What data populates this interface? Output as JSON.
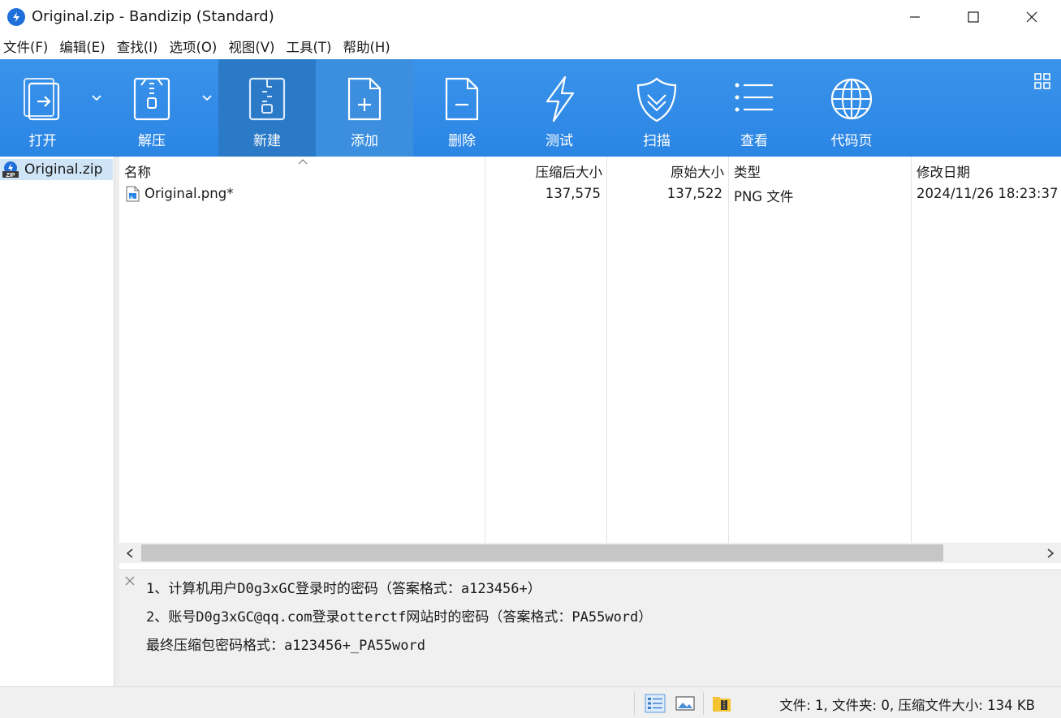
{
  "window": {
    "title": "Original.zip - Bandizip (Standard)",
    "app_icon": "bandizip-icon",
    "controls": [
      "minimize-icon",
      "maximize-icon",
      "close-icon"
    ]
  },
  "menu": [
    "文件(F)",
    "编辑(E)",
    "查找(I)",
    "选项(O)",
    "视图(V)",
    "工具(T)",
    "帮助(H)"
  ],
  "toolbar": {
    "accent": "#2b85e4",
    "items": [
      {
        "label": "打开",
        "icon": "open-icon",
        "dropdown": true
      },
      {
        "label": "解压",
        "icon": "extract-icon",
        "dropdown": true
      },
      {
        "label": "新建",
        "icon": "new-archive-icon",
        "state": "active"
      },
      {
        "label": "添加",
        "icon": "add-file-icon",
        "state": "hover"
      },
      {
        "label": "删除",
        "icon": "delete-file-icon"
      },
      {
        "label": "测试",
        "icon": "test-icon"
      },
      {
        "label": "扫描",
        "icon": "scan-shield-icon"
      },
      {
        "label": "查看",
        "icon": "view-list-icon"
      },
      {
        "label": "代码页",
        "icon": "codepage-globe-icon"
      }
    ],
    "layout_button_icon": "grid-layout-icon"
  },
  "tree": {
    "items": [
      {
        "label": "Original.zip",
        "icon": "zip-icon",
        "selected": true
      }
    ]
  },
  "filelist": {
    "columns": [
      "名称",
      "压缩后大小",
      "原始大小",
      "类型",
      "修改日期"
    ],
    "sorted_column": "名称",
    "rows": [
      {
        "name": "Original.png*",
        "compressed": "137,575",
        "original": "137,522",
        "type": "PNG 文件",
        "modified": "2024/11/26 18:23:37"
      }
    ]
  },
  "comment": {
    "lines": [
      "1、计算机用户D0g3xGC登录时的密码（答案格式：a123456+）",
      "2、账号D0g3xGC@qq.com登录otterctf网站时的密码（答案格式：PA55word）",
      "最终压缩包密码格式：a123456+_PA55word"
    ]
  },
  "statusbar": {
    "text": "文件: 1, 文件夹: 0, 压缩文件大小: 134 KB",
    "icons": [
      "details-view-icon",
      "thumbnail-view-icon",
      "archive-folder-icon"
    ]
  }
}
